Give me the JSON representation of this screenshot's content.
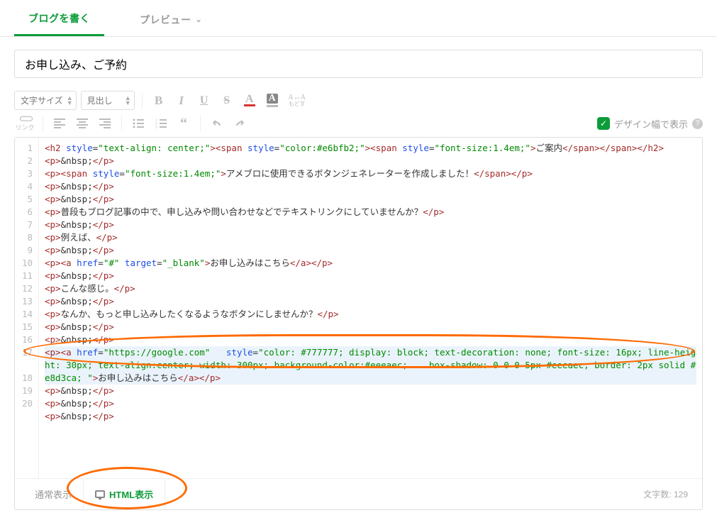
{
  "tabs": {
    "write": "ブログを書く",
    "preview": "プレビュー"
  },
  "title_value": "お申し込み、ご予約",
  "toolbar": {
    "font_size_label": "文字サイズ",
    "heading_label": "見出し",
    "link_label": "リンク",
    "bold": "B",
    "italic": "I",
    "underline": "U",
    "strike": "S",
    "text_color_letter": "A",
    "highlight_letter": "A",
    "reset_top": "A↔A",
    "reset_bottom": "もどす",
    "design_width_label": "デザイン幅で表示",
    "design_width_checked": true
  },
  "code_lines": [
    {
      "n": 1,
      "segments": [
        {
          "t": "tag",
          "v": "<h2"
        },
        {
          "t": "txt",
          "v": " "
        },
        {
          "t": "attr",
          "v": "style"
        },
        {
          "t": "txt",
          "v": "="
        },
        {
          "t": "str",
          "v": "\"text-align: center;\""
        },
        {
          "t": "tag",
          "v": "><span"
        },
        {
          "t": "txt",
          "v": " "
        },
        {
          "t": "attr",
          "v": "style"
        },
        {
          "t": "txt",
          "v": "="
        },
        {
          "t": "str",
          "v": "\"color:#e6bfb2;\""
        },
        {
          "t": "tag",
          "v": "><span"
        },
        {
          "t": "txt",
          "v": " "
        },
        {
          "t": "attr",
          "v": "style"
        },
        {
          "t": "txt",
          "v": "="
        },
        {
          "t": "str",
          "v": "\"font-size:1.4em;\""
        },
        {
          "t": "tag",
          "v": ">"
        },
        {
          "t": "txt",
          "v": "ご案内"
        },
        {
          "t": "tag",
          "v": "</span></span></h2>"
        }
      ]
    },
    {
      "n": 2,
      "segments": [
        {
          "t": "tag",
          "v": "<p>"
        },
        {
          "t": "txt",
          "v": "&nbsp;"
        },
        {
          "t": "tag",
          "v": "</p>"
        }
      ]
    },
    {
      "n": 3,
      "segments": [
        {
          "t": "tag",
          "v": "<p><span"
        },
        {
          "t": "txt",
          "v": " "
        },
        {
          "t": "attr",
          "v": "style"
        },
        {
          "t": "txt",
          "v": "="
        },
        {
          "t": "str",
          "v": "\"font-size:1.4em;\""
        },
        {
          "t": "tag",
          "v": ">"
        },
        {
          "t": "txt",
          "v": "アメブロに使用できるボタンジェネレーターを作成しました！"
        },
        {
          "t": "tag",
          "v": "</span></p>"
        }
      ]
    },
    {
      "n": 4,
      "segments": [
        {
          "t": "tag",
          "v": "<p>"
        },
        {
          "t": "txt",
          "v": "&nbsp;"
        },
        {
          "t": "tag",
          "v": "</p>"
        }
      ]
    },
    {
      "n": 5,
      "segments": [
        {
          "t": "tag",
          "v": "<p>"
        },
        {
          "t": "txt",
          "v": "&nbsp;"
        },
        {
          "t": "tag",
          "v": "</p>"
        }
      ]
    },
    {
      "n": 6,
      "segments": [
        {
          "t": "tag",
          "v": "<p>"
        },
        {
          "t": "txt",
          "v": "普段もブログ記事の中で、申し込みや問い合わせなどでテキストリンクにしていませんか？"
        },
        {
          "t": "tag",
          "v": "</p>"
        }
      ]
    },
    {
      "n": 7,
      "segments": [
        {
          "t": "tag",
          "v": "<p>"
        },
        {
          "t": "txt",
          "v": "&nbsp;"
        },
        {
          "t": "tag",
          "v": "</p>"
        }
      ]
    },
    {
      "n": 8,
      "segments": [
        {
          "t": "tag",
          "v": "<p>"
        },
        {
          "t": "txt",
          "v": "例えば、"
        },
        {
          "t": "tag",
          "v": "</p>"
        }
      ]
    },
    {
      "n": 9,
      "segments": [
        {
          "t": "tag",
          "v": "<p>"
        },
        {
          "t": "txt",
          "v": "&nbsp;"
        },
        {
          "t": "tag",
          "v": "</p>"
        }
      ]
    },
    {
      "n": 10,
      "segments": [
        {
          "t": "tag",
          "v": "<p><a"
        },
        {
          "t": "txt",
          "v": " "
        },
        {
          "t": "attr",
          "v": "href"
        },
        {
          "t": "txt",
          "v": "="
        },
        {
          "t": "str",
          "v": "\"#\""
        },
        {
          "t": "txt",
          "v": " "
        },
        {
          "t": "attr",
          "v": "target"
        },
        {
          "t": "txt",
          "v": "="
        },
        {
          "t": "str",
          "v": "\"_blank\""
        },
        {
          "t": "tag",
          "v": ">"
        },
        {
          "t": "txt",
          "v": "お申し込みはこちら"
        },
        {
          "t": "tag",
          "v": "</a></p>"
        }
      ]
    },
    {
      "n": 11,
      "segments": [
        {
          "t": "tag",
          "v": "<p>"
        },
        {
          "t": "txt",
          "v": "&nbsp;"
        },
        {
          "t": "tag",
          "v": "</p>"
        }
      ]
    },
    {
      "n": 12,
      "segments": [
        {
          "t": "tag",
          "v": "<p>"
        },
        {
          "t": "txt",
          "v": "こんな感じ。"
        },
        {
          "t": "tag",
          "v": "</p>"
        }
      ]
    },
    {
      "n": 13,
      "segments": [
        {
          "t": "tag",
          "v": "<p>"
        },
        {
          "t": "txt",
          "v": "&nbsp;"
        },
        {
          "t": "tag",
          "v": "</p>"
        }
      ]
    },
    {
      "n": 14,
      "segments": [
        {
          "t": "tag",
          "v": "<p>"
        },
        {
          "t": "txt",
          "v": "なんか、もっと申し込みしたくなるようなボタンにしませんか？"
        },
        {
          "t": "tag",
          "v": "</p>"
        }
      ]
    },
    {
      "n": 15,
      "segments": [
        {
          "t": "tag",
          "v": "<p>"
        },
        {
          "t": "txt",
          "v": "&nbsp;"
        },
        {
          "t": "tag",
          "v": "</p>"
        }
      ]
    },
    {
      "n": 16,
      "segments": [
        {
          "t": "tag",
          "v": "<p>"
        },
        {
          "t": "txt",
          "v": "&nbsp;"
        },
        {
          "t": "tag",
          "v": "</p>"
        }
      ]
    },
    {
      "n": 17,
      "hl": true,
      "segments": [
        {
          "t": "tag",
          "v": "<p><a"
        },
        {
          "t": "txt",
          "v": " "
        },
        {
          "t": "attr",
          "v": "href"
        },
        {
          "t": "txt",
          "v": "="
        },
        {
          "t": "str",
          "v": "\"https://google.com\""
        },
        {
          "t": "txt",
          "v": "   "
        },
        {
          "t": "attr",
          "v": "style"
        },
        {
          "t": "txt",
          "v": "="
        },
        {
          "t": "str",
          "v": "\"color: #777777; display: block; text-decoration: none; font-size: 16px; line-height: 30px; text-align:center; width: 300px; background-color:#eeeaec;    box-shadow: 0 0 0 5px #eeeaec; border: 2px solid #e8d3ca; \""
        },
        {
          "t": "tag",
          "v": ">"
        },
        {
          "t": "txt",
          "v": "お申し込みはこちら"
        },
        {
          "t": "tag",
          "v": "</a></p>"
        }
      ]
    },
    {
      "n": 18,
      "segments": [
        {
          "t": "tag",
          "v": "<p>"
        },
        {
          "t": "txt",
          "v": "&nbsp;"
        },
        {
          "t": "tag",
          "v": "</p>"
        }
      ]
    },
    {
      "n": 19,
      "segments": [
        {
          "t": "tag",
          "v": "<p>"
        },
        {
          "t": "txt",
          "v": "&nbsp;"
        },
        {
          "t": "tag",
          "v": "</p>"
        }
      ]
    },
    {
      "n": 20,
      "segments": [
        {
          "t": "tag",
          "v": "<p>"
        },
        {
          "t": "txt",
          "v": "&nbsp;"
        },
        {
          "t": "tag",
          "v": "</p>"
        }
      ]
    }
  ],
  "bottom": {
    "normal_view": "通常表示",
    "html_view": "HTML表示",
    "char_count_label": "文字数:",
    "char_count_value": "129"
  }
}
